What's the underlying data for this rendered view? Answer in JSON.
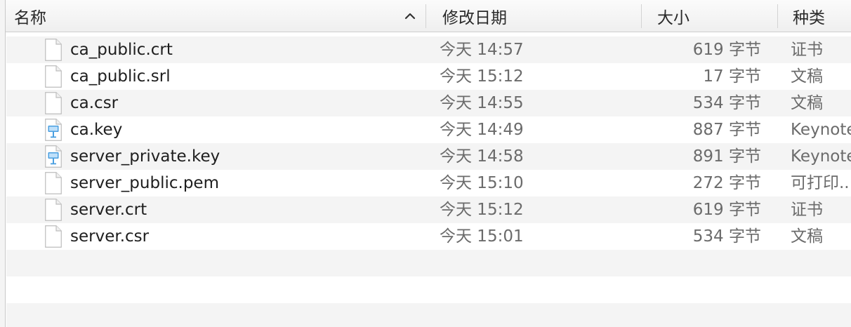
{
  "header": {
    "name_label": "名称",
    "date_label": "修改日期",
    "size_label": "大小",
    "kind_label": "种类"
  },
  "files": [
    {
      "name": "ca_public.crt",
      "date": "今天 14:57",
      "size": "619 字节",
      "kind": "证书",
      "icon": "document-icon"
    },
    {
      "name": "ca_public.srl",
      "date": "今天 15:12",
      "size": "17 字节",
      "kind": "文稿",
      "icon": "document-icon"
    },
    {
      "name": "ca.csr",
      "date": "今天 14:55",
      "size": "534 字节",
      "kind": "文稿",
      "icon": "document-icon"
    },
    {
      "name": "ca.key",
      "date": "今天 14:49",
      "size": "887 字节",
      "kind": "Keynote",
      "icon": "keynote-icon"
    },
    {
      "name": "server_private.key",
      "date": "今天 14:58",
      "size": "891 字节",
      "kind": "Keynote",
      "icon": "keynote-icon"
    },
    {
      "name": "server_public.pem",
      "date": "今天 15:10",
      "size": "272 字节",
      "kind": "可打印...",
      "icon": "document-icon"
    },
    {
      "name": "server.crt",
      "date": "今天 15:12",
      "size": "619 字节",
      "kind": "证书",
      "icon": "document-icon"
    },
    {
      "name": "server.csr",
      "date": "今天 15:01",
      "size": "534 字节",
      "kind": "文稿",
      "icon": "document-icon"
    }
  ],
  "colors": {
    "row_alt": "#f4f4f4",
    "keynote_blue": "#4a9fe0"
  }
}
